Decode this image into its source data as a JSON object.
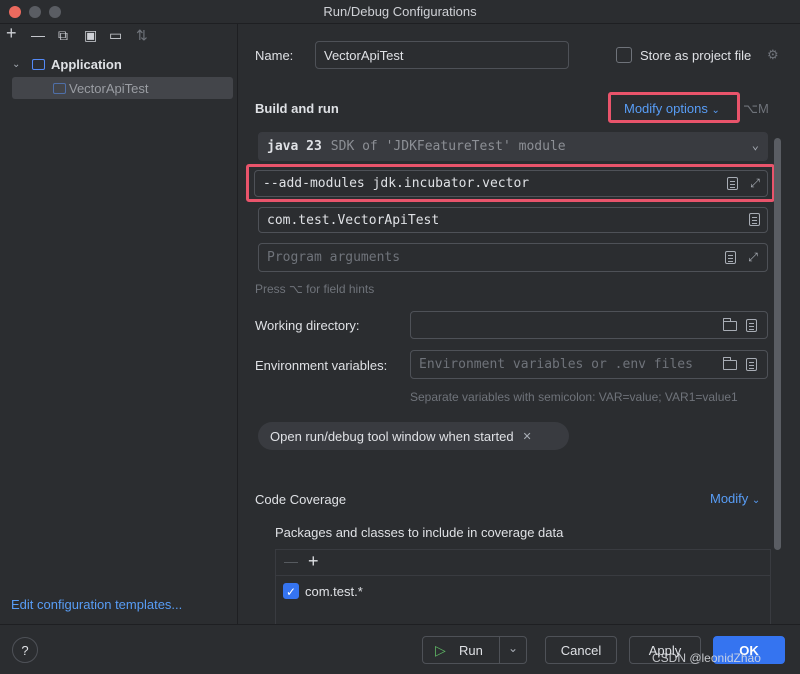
{
  "window": {
    "title": "Run/Debug Configurations"
  },
  "sidebar": {
    "toolbar": [
      {
        "name": "add-icon",
        "glyph": "+"
      },
      {
        "name": "remove-icon",
        "glyph": "—"
      },
      {
        "name": "copy-icon",
        "glyph": "⧉"
      },
      {
        "name": "save-icon",
        "glyph": "▣"
      },
      {
        "name": "new-folder-icon",
        "glyph": "▭"
      },
      {
        "name": "sort-icon",
        "glyph": "⇅"
      }
    ],
    "tree": {
      "group_label": "Application",
      "item_label": "VectorApiTest"
    },
    "edit_templates_label": "Edit configuration templates..."
  },
  "main": {
    "name_label": "Name:",
    "name_value": "VectorApiTest",
    "store_label": "Store as project file",
    "build_run_title": "Build and run",
    "modify_options_label": "Modify options",
    "modify_options_shortcut": "⌥M",
    "jdk": {
      "version": "java 23",
      "description": "SDK of 'JDKFeatureTest' module"
    },
    "vm_options_value": "--add-modules jdk.incubator.vector",
    "main_class_value": "com.test.VectorApiTest",
    "program_args_placeholder": "Program arguments",
    "field_hints_text": "Press ⌥ for field hints",
    "working_dir_label": "Working directory:",
    "env_vars_label": "Environment variables:",
    "env_vars_placeholder": "Environment variables or .env files",
    "env_vars_hint": "Separate variables with semicolon: VAR=value; VAR1=value1",
    "chip_label": "Open run/debug tool window when started",
    "code_coverage_title": "Code Coverage",
    "coverage_modify_label": "Modify",
    "packages_label": "Packages and classes to include in coverage data",
    "coverage_entry": "com.test.*"
  },
  "bottom": {
    "help_label": "?",
    "run_label": "Run",
    "cancel_label": "Cancel",
    "apply_label": "Apply",
    "ok_label": "OK",
    "watermark": "CSDN @leonidZhao"
  },
  "colors": {
    "accent": "#3574f0",
    "link": "#589df6",
    "highlight_box": "#e9546b",
    "background": "#2b2d30"
  }
}
